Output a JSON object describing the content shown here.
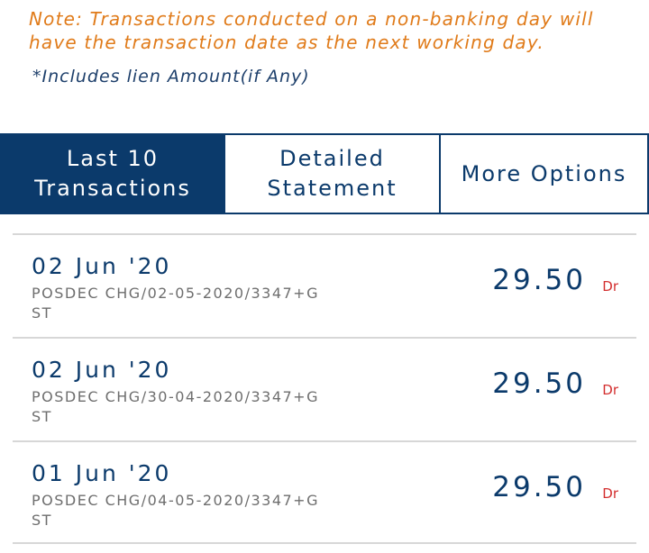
{
  "note": "Note: Transactions conducted on a non-banking day will have the transaction date as the next working day.",
  "lien_note": "*Includes lien Amount(if Any)",
  "tabs": [
    {
      "label": "Last 10 Transactions",
      "active": true
    },
    {
      "label": "Detailed Statement",
      "active": false
    },
    {
      "label": "More Options",
      "active": false
    }
  ],
  "transactions": [
    {
      "date": "02 Jun '20",
      "description": "POSDEC CHG/02-05-2020/3347+GST",
      "amount": "29.50",
      "type": "Dr"
    },
    {
      "date": "02 Jun '20",
      "description": "POSDEC CHG/30-04-2020/3347+GST",
      "amount": "29.50",
      "type": "Dr"
    },
    {
      "date": "01 Jun '20",
      "description": "POSDEC CHG/04-05-2020/3347+GST",
      "amount": "29.50",
      "type": "Dr"
    }
  ],
  "colors": {
    "primary": "#0b3a6b",
    "note": "#e07b1a",
    "debit": "#d32f2f",
    "muted": "#6e6e6e"
  }
}
